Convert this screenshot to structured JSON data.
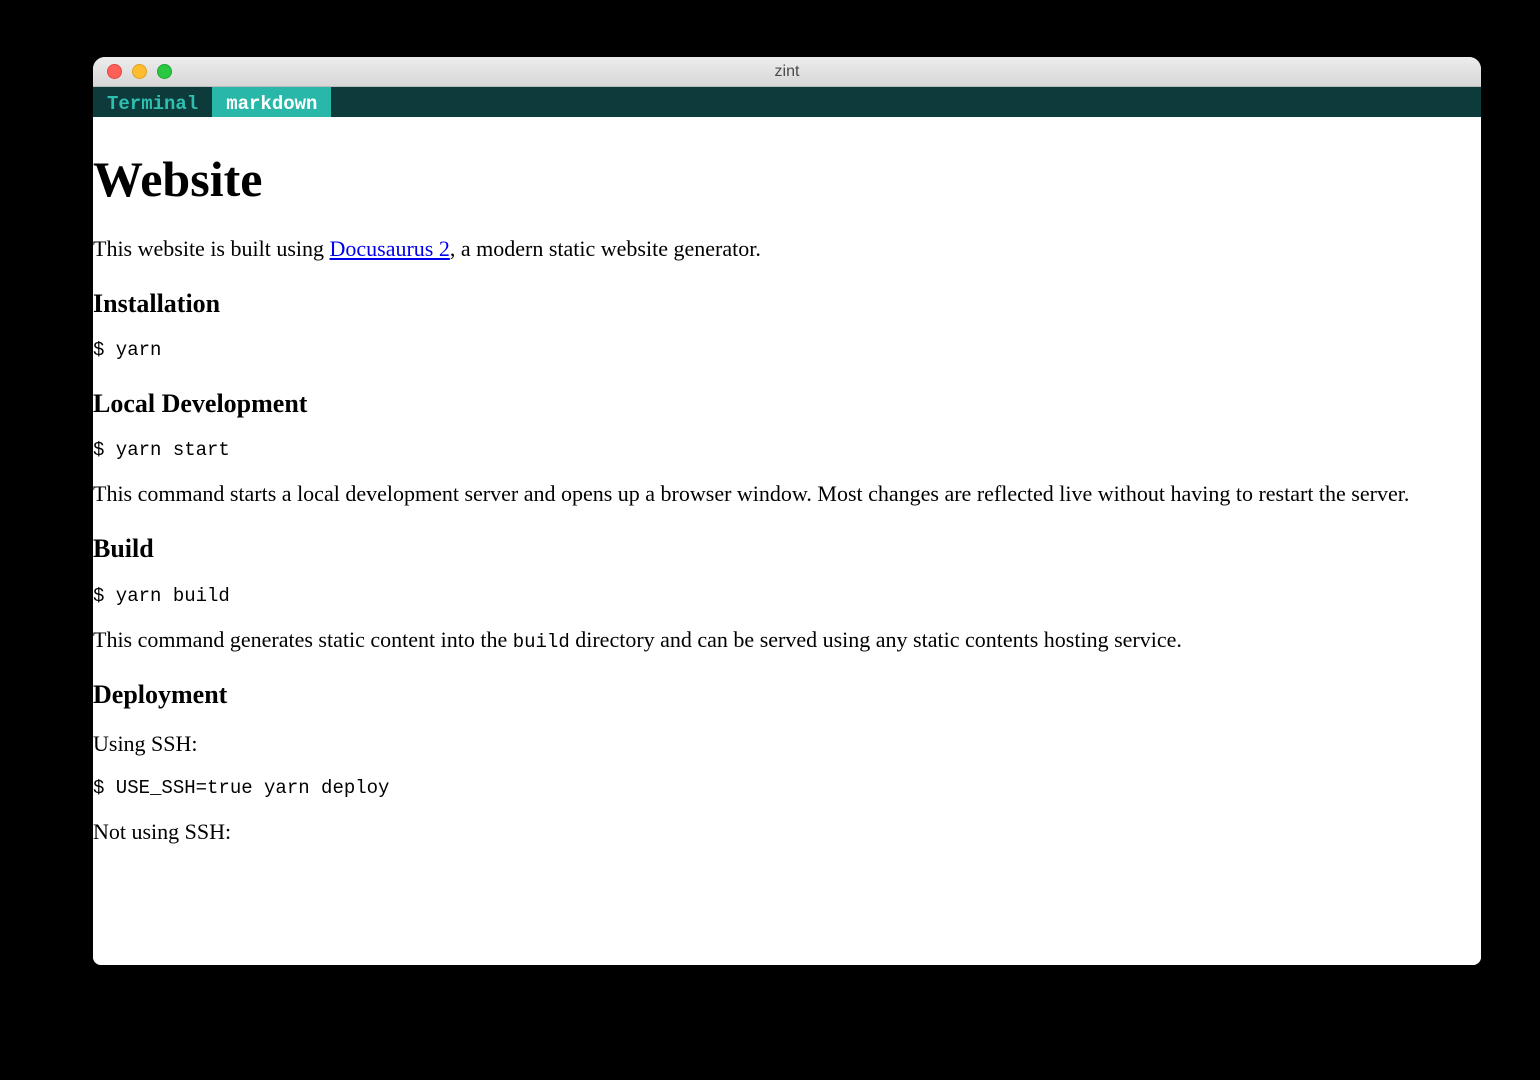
{
  "window": {
    "title": "zint"
  },
  "tabs": {
    "inactive": "Terminal",
    "active": "markdown"
  },
  "doc": {
    "h1": "Website",
    "intro": {
      "before": "This website is built using ",
      "link": "Docusaurus 2",
      "after": ", a modern static website generator."
    },
    "sections": {
      "installation": {
        "heading": "Installation",
        "cmd": "$ yarn"
      },
      "localdev": {
        "heading": "Local Development",
        "cmd": "$ yarn start",
        "desc": "This command starts a local development server and opens up a browser window. Most changes are reflected live without having to restart the server."
      },
      "build": {
        "heading": "Build",
        "cmd": "$ yarn build",
        "desc": {
          "before": "This command generates static content into the ",
          "code": "build",
          "after": " directory and can be served using any static contents hosting service."
        }
      },
      "deploy": {
        "heading": "Deployment",
        "using_ssh": "Using SSH:",
        "cmd": "$ USE_SSH=true yarn deploy",
        "not_using_ssh": "Not using SSH:"
      }
    }
  }
}
